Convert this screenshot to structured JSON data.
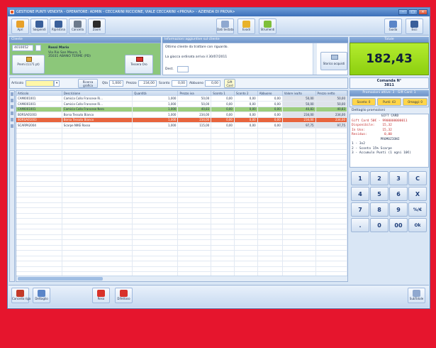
{
  "window": {
    "title": "GESTIONE PUNTI VENDITA - OPERATORE: ADMIN - CECCARINI RICCIONE, VIALE CECCARINI <PROVA> - AZIENDA DI PROVA>"
  },
  "toolbar": {
    "left": [
      {
        "label": "Apri",
        "icon": "open-icon"
      },
      {
        "label": "Sospendi",
        "icon": "save-icon"
      },
      {
        "label": "Ripristina",
        "icon": "restore-icon"
      },
      {
        "label": "Cancella",
        "icon": "trash-icon"
      },
      {
        "label": "Zoom",
        "icon": "binoculars-icon"
      }
    ],
    "mid": [
      {
        "label": "Dati testata",
        "icon": "document-icon"
      },
      {
        "label": "Evadi",
        "icon": "box-icon"
      },
      {
        "label": "Strumenti",
        "icon": "tools-icon"
      }
    ],
    "right": [
      {
        "label": "Guida",
        "icon": "help-icon"
      },
      {
        "label": "Esci",
        "icon": "exit-icon"
      }
    ]
  },
  "cliente": {
    "header": "Cliente",
    "code": "4010052",
    "name": "Rossi Mario",
    "address1": "Via Rio San Mauro, 5",
    "address2": "35031 ABANO TERME (PD)",
    "points_btn": "Premi (1171 pt)",
    "card_btn": "Tessera Oro"
  },
  "info": {
    "header": "Informazioni aggiuntive sul cliente",
    "lines": [
      "Ottimo cliente da trattare con riguardo.",
      "La giacca ordinata arriva il 30/07/2011"
    ],
    "dest_label": "Dest.",
    "storico_btn": "Storico acquisti"
  },
  "totale": {
    "header": "Totale",
    "value": "182,43"
  },
  "comanda": {
    "label": "Comanda N°",
    "number": "3811"
  },
  "entry": {
    "articolo_label": "Articolo",
    "ricerca_btn": "Ricerca grafica",
    "qta_label": "Qta",
    "qta_value": "1,000",
    "prezzo_label": "Prezzo",
    "prezzo_value": "234,00",
    "sconto_label": "Sconto",
    "sconto_value": "0,00",
    "abbuono_label": "Abbuono",
    "abbuono_value": "0,00",
    "gift_btn": "Gift Card"
  },
  "table": {
    "columns": [
      "Articolo",
      "Descrizione",
      "Quantità",
      "Prezzo iva",
      "Sconto 1",
      "Sconto 2",
      "Abbuono",
      "Valore iva/to",
      "Prezzo netto"
    ],
    "rows": [
      {
        "cells": [
          "CAMI001001",
          "Camicia Collo Francese Ri...",
          "1,000",
          "50,00",
          "0,00",
          "0,00",
          "0,00",
          "50,00",
          "50,00"
        ],
        "style": ""
      },
      {
        "cells": [
          "CAMI001001",
          "Camicia Collo Francese Ri...",
          "1,000",
          "50,00",
          "0,00",
          "0,00",
          "0,00",
          "50,00",
          "50,00"
        ],
        "style": ""
      },
      {
        "cells": [
          "CAMI001001",
          "Camicia Collo Francese Nero",
          "1,000",
          "40,83",
          "0,00",
          "0,00",
          "0,00",
          "40,83",
          "40,83"
        ],
        "style": "green"
      },
      {
        "cells": [
          "BORSA01003",
          "Borsa Tessuto Bianco",
          "1,000",
          "234,00",
          "0,00",
          "0,00",
          "0,00",
          "234,00",
          "234,00"
        ],
        "style": ""
      },
      {
        "cells": [
          "BORSA01003",
          "Borsa Tessuto Bianco",
          "1,000",
          "234,00",
          "0,00",
          "0,00",
          "0,00",
          "234,00",
          "234,00"
        ],
        "style": "red"
      },
      {
        "cells": [
          "SCARPA2004",
          "Scarpe NIKE Rosso",
          "1,000",
          "115,00",
          "0,00",
          "0,00",
          "0,00",
          "97,75",
          "97,75"
        ],
        "style": ""
      }
    ]
  },
  "promo": {
    "header": "Promozioni attive: 3 - Gift Card: 1",
    "sconto_btn": "Sconto: 0",
    "punti_btn": "Punti: 43",
    "omaggi_btn": "Omaggi: 0",
    "detail_header": "Dettaglio promozioni",
    "detail_lines": [
      "GIFT CARD",
      "Gift Card 50€ - 9900000000011",
      "Disponibile:    15,32",
      "In Uso:         15,32",
      "Residuo:         0,00",
      "PROMOZIONI",
      "1 - 3x2",
      "2 - Sconto 15% Scarpe",
      "3 - Accumulo Punti (1 ogni 10€)"
    ]
  },
  "keypad": [
    "1",
    "2",
    "3",
    "C",
    "4",
    "5",
    "6",
    "X",
    "7",
    "8",
    "9",
    "%/€",
    ".",
    "0",
    "00",
    "Ok"
  ],
  "bottom": {
    "left": [
      {
        "label": "Cancella riga",
        "icon": "delete-row-icon"
      },
      {
        "label": "Dettaglio",
        "icon": "detail-icon"
      },
      {
        "label": "Reso",
        "icon": "return-icon"
      },
      {
        "label": "Difettoso",
        "icon": "defective-icon"
      }
    ],
    "right": {
      "label": "SubTotale",
      "icon": "subtotal-icon"
    }
  }
}
